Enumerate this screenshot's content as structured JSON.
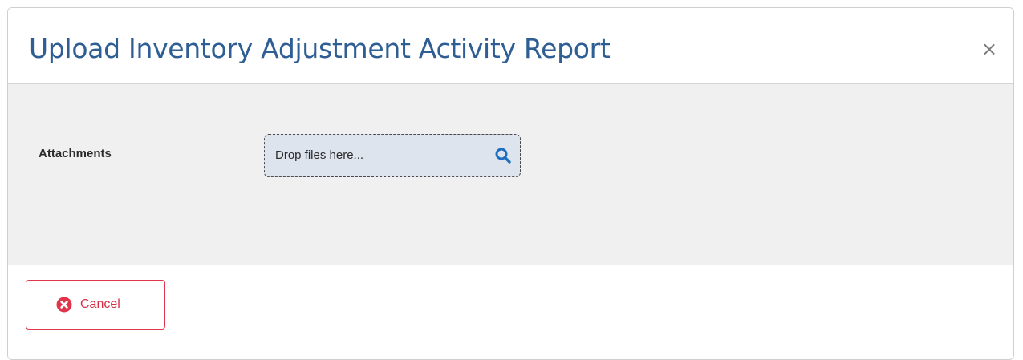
{
  "dialog": {
    "title": "Upload Inventory Adjustment Activity Report",
    "close_label": "×",
    "close_icon": "close-icon"
  },
  "form": {
    "attachments_label": "Attachments",
    "dropzone_placeholder": "Drop files here...",
    "dropzone_icon": "search-icon"
  },
  "footer": {
    "cancel_label": "Cancel",
    "cancel_icon": "times-circle-icon"
  },
  "colors": {
    "title": "#2e5e93",
    "body_background": "#f0f0f0",
    "dropzone_background": "#dde4ee",
    "search_icon": "#1f6fc0",
    "cancel_accent": "#e0354a"
  }
}
